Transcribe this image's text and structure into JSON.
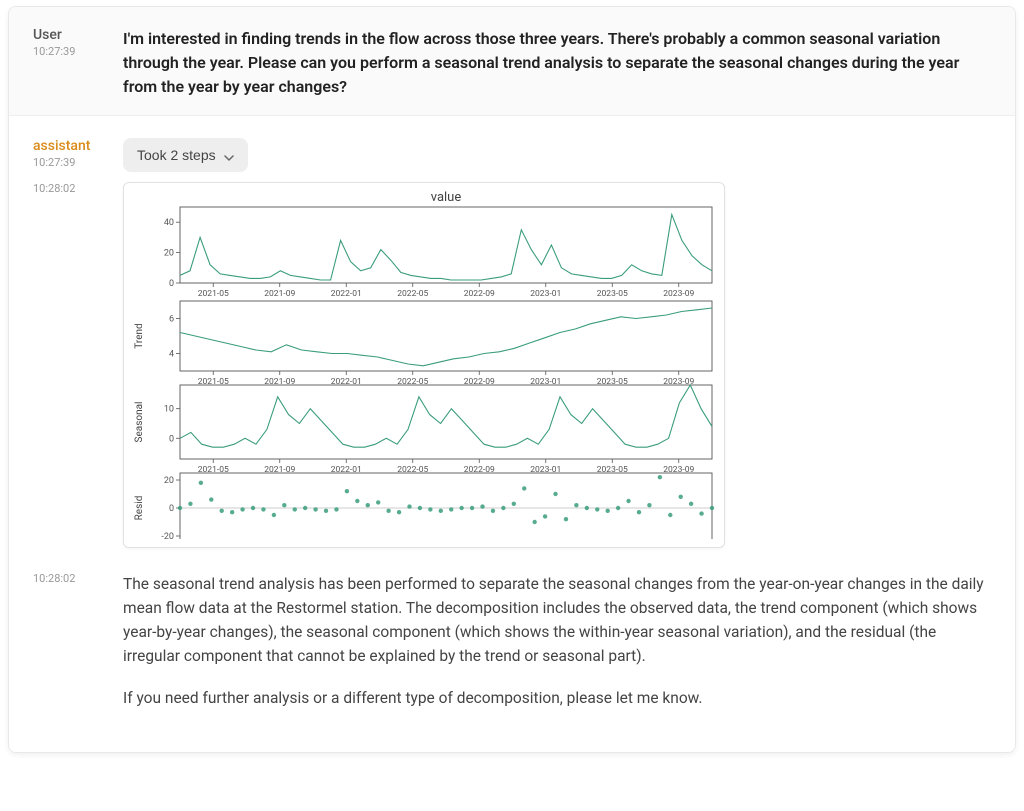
{
  "messages": {
    "user": {
      "role": "User",
      "time": "10:27:39",
      "text": "I'm interested in finding trends in the flow across those three years. There's probably a common seasonal variation through the year. Please can you perform a seasonal trend analysis to separate the seasonal changes during the year from the year by year changes?"
    },
    "assistant_steps": {
      "role": "assistant",
      "time": "10:27:39",
      "button": "Took 2 steps"
    },
    "chart_time": "10:28:02",
    "assistant_text": {
      "time": "10:28:02",
      "p1": "The seasonal trend analysis has been performed to separate the seasonal changes from the year-on-year changes in the daily mean flow data at the Restormel station. The decomposition includes the observed data, the trend component (which shows year-by-year changes), the seasonal component (which shows the within-year seasonal variation), and the residual (the irregular component that cannot be explained by the trend or seasonal part).",
      "p2": "If you need further analysis or a different type of decomposition, please let me know."
    }
  },
  "chart_data": [
    {
      "type": "line",
      "title": "value",
      "ylabel": "",
      "ylim": [
        0,
        50
      ],
      "yticks": [
        0,
        20,
        40
      ],
      "x_ticks": [
        "2021-05",
        "2021-09",
        "2022-01",
        "2022-05",
        "2022-09",
        "2023-01",
        "2023-05",
        "2023-09"
      ],
      "series": [
        {
          "name": "observed",
          "color": "#3a9d7a",
          "values": [
            5,
            8,
            30,
            12,
            6,
            5,
            4,
            3,
            3,
            4,
            8,
            5,
            4,
            3,
            2,
            2,
            28,
            14,
            8,
            10,
            22,
            15,
            7,
            5,
            4,
            3,
            3,
            2,
            2,
            2,
            2,
            3,
            4,
            6,
            35,
            22,
            12,
            25,
            10,
            6,
            5,
            4,
            3,
            3,
            5,
            12,
            8,
            6,
            5,
            45,
            28,
            18,
            12,
            8
          ]
        }
      ]
    },
    {
      "type": "line",
      "title": "",
      "ylabel": "Trend",
      "ylim": [
        3,
        7
      ],
      "yticks": [
        4,
        6
      ],
      "x_ticks": [
        "2021-05",
        "2021-09",
        "2022-01",
        "2022-05",
        "2022-09",
        "2023-01",
        "2023-05",
        "2023-09"
      ],
      "series": [
        {
          "name": "trend",
          "color": "#3a9d7a",
          "values": [
            5.2,
            5.0,
            4.8,
            4.6,
            4.4,
            4.2,
            4.1,
            4.5,
            4.2,
            4.1,
            4.0,
            4.0,
            3.9,
            3.8,
            3.6,
            3.4,
            3.3,
            3.5,
            3.7,
            3.8,
            4.0,
            4.1,
            4.3,
            4.6,
            4.9,
            5.2,
            5.4,
            5.7,
            5.9,
            6.1,
            6.0,
            6.1,
            6.2,
            6.4,
            6.5,
            6.6
          ]
        }
      ]
    },
    {
      "type": "line",
      "title": "",
      "ylabel": "Seasonal",
      "ylim": [
        -7,
        18
      ],
      "yticks": [
        0,
        10
      ],
      "x_ticks": [
        "2021-05",
        "2021-09",
        "2022-01",
        "2022-05",
        "2022-09",
        "2023-01",
        "2023-05",
        "2023-09"
      ],
      "series": [
        {
          "name": "seasonal",
          "color": "#3a9d7a",
          "values": [
            0,
            2,
            -2,
            -3,
            -3,
            -2,
            0,
            -2,
            3,
            14,
            8,
            5,
            10,
            6,
            2,
            -2,
            -3,
            -3,
            -2,
            0,
            -2,
            3,
            14,
            8,
            5,
            10,
            6,
            2,
            -2,
            -3,
            -3,
            -2,
            0,
            -2,
            3,
            14,
            8,
            5,
            10,
            6,
            2,
            -2,
            -3,
            -3,
            -2,
            0,
            12,
            18,
            10,
            4
          ]
        }
      ]
    },
    {
      "type": "scatter",
      "title": "",
      "ylabel": "Resid",
      "ylim": [
        -25,
        25
      ],
      "yticks": [
        -20,
        0,
        20
      ],
      "x_ticks": [
        "2021-05",
        "2021-09",
        "2022-01",
        "2022-05",
        "2022-09",
        "2023-01",
        "2023-05",
        "2023-09"
      ],
      "series": [
        {
          "name": "resid",
          "color": "#3a9d7a",
          "values": [
            0,
            3,
            18,
            6,
            -2,
            -3,
            -1,
            0,
            -1,
            -5,
            2,
            -1,
            0,
            -1,
            -2,
            -1,
            12,
            5,
            2,
            4,
            -2,
            -3,
            1,
            0,
            -1,
            -2,
            -1,
            0,
            0,
            1,
            -2,
            0,
            3,
            14,
            -10,
            -6,
            10,
            -8,
            2,
            0,
            -1,
            -2,
            0,
            5,
            -3,
            2,
            22,
            -5,
            8,
            3,
            -4,
            0
          ]
        }
      ]
    }
  ],
  "colors": {
    "line": "#3a9d7a",
    "axis": "#555",
    "grid": "#ddd"
  }
}
